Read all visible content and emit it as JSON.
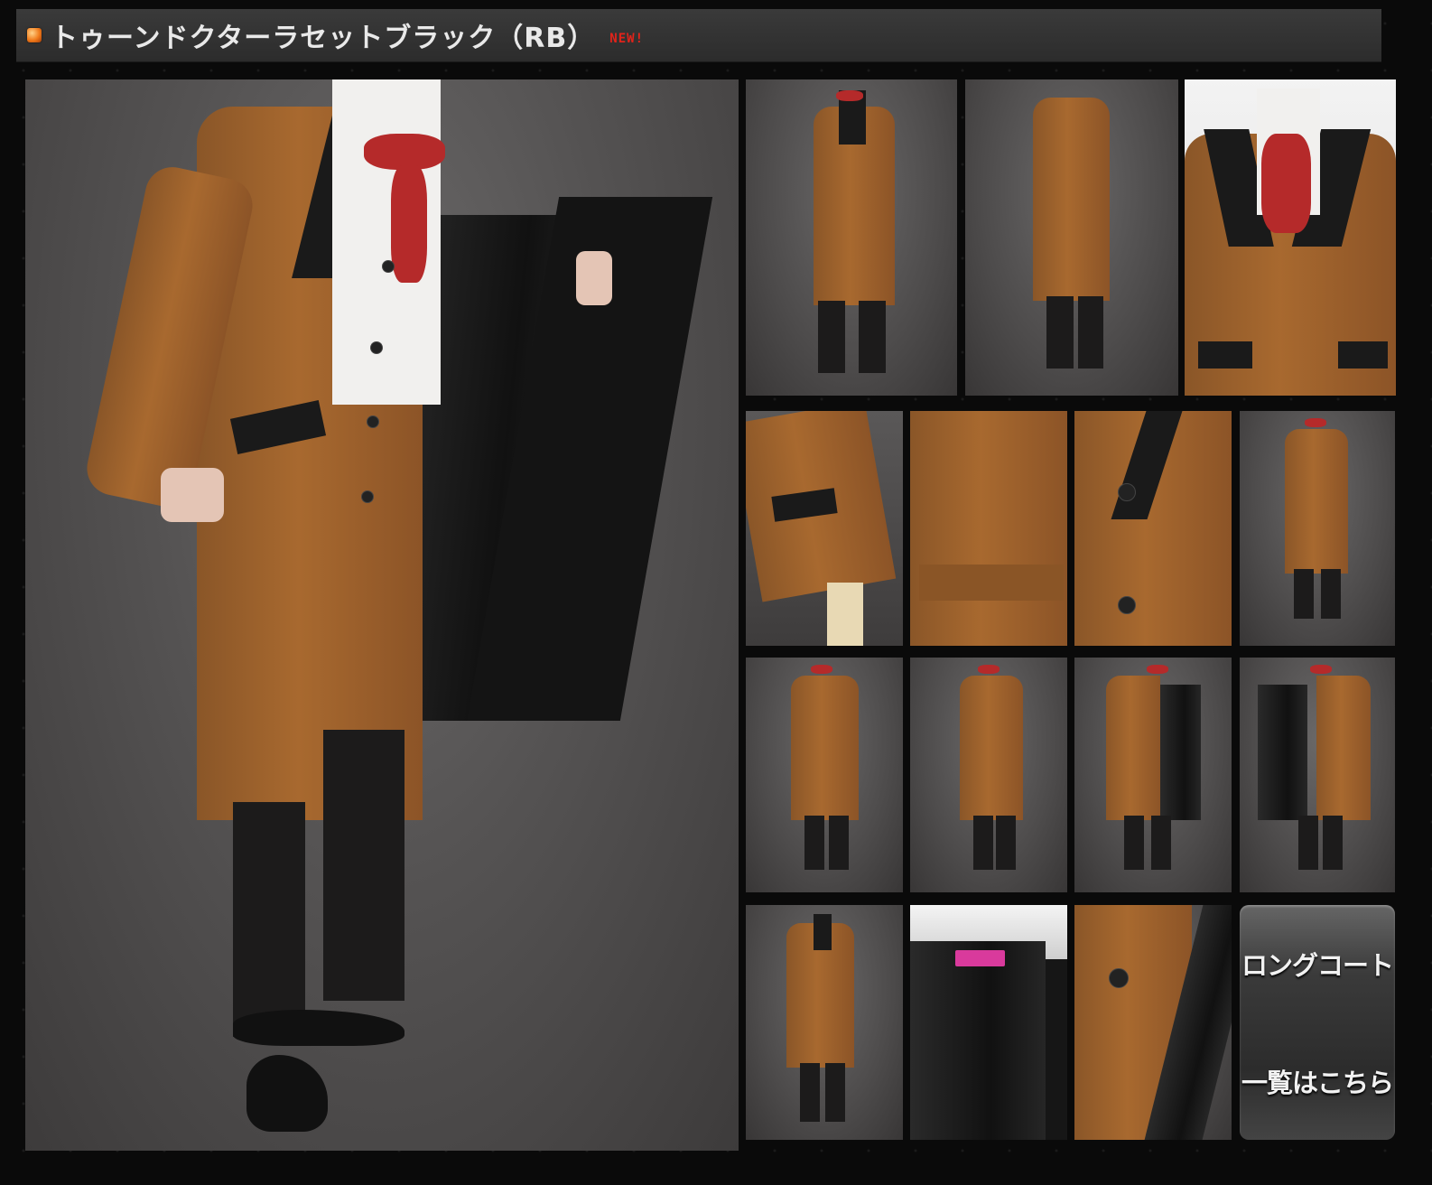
{
  "header": {
    "title": "トゥーンドクターラセットブラック（RB）",
    "badge": "NEW!"
  },
  "gallery": {
    "main_image_name": "coat-front-open",
    "thumbnails": [
      "coat-front",
      "coat-back",
      "coat-mannequin-closeup",
      "sleeve-detail",
      "back-belt-detail",
      "lapel-button-detail",
      "coat-front-full",
      "coat-arms-out",
      "coat-side-turn",
      "coat-open-left",
      "coat-open-right",
      "coat-front-plain",
      "collar-label-detail",
      "button-lining-detail"
    ]
  },
  "link_tile": {
    "line1": "ロングコート",
    "line2": "一覧はこちら"
  }
}
